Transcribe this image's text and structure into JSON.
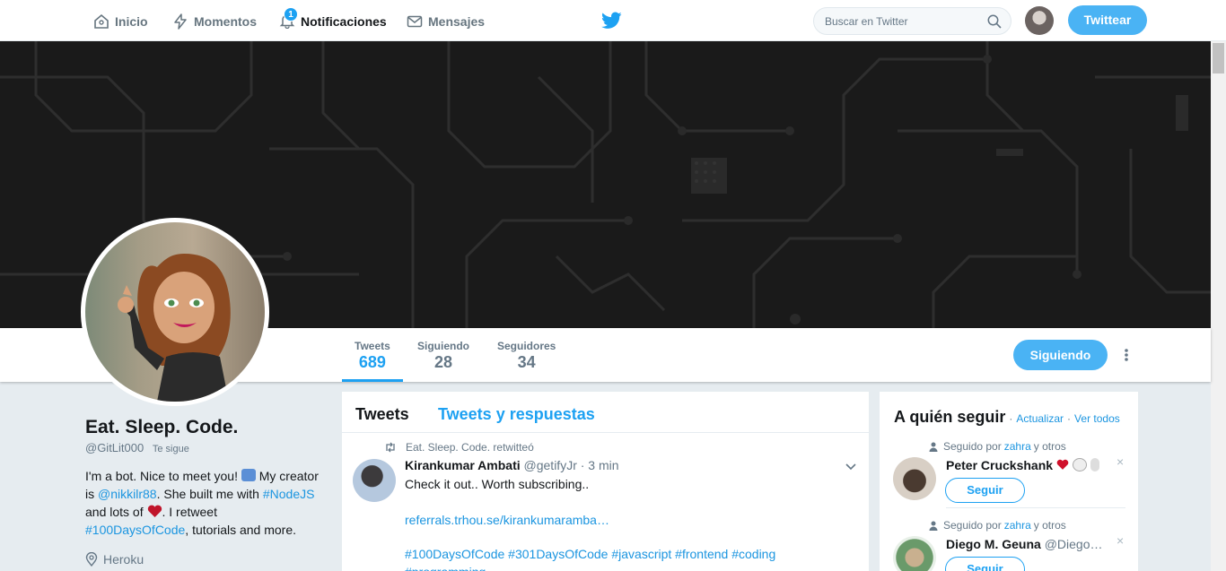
{
  "nav": {
    "home": "Inicio",
    "moments": "Momentos",
    "notifications": "Notificaciones",
    "notifications_count": "1",
    "messages": "Mensajes",
    "search_placeholder": "Buscar en Twitter",
    "tweet_button": "Twittear"
  },
  "profile": {
    "name": "Eat. Sleep. Code.",
    "handle": "@GitLit000",
    "follows_you": "Te sigue",
    "bio": {
      "part1": "I'm a bot. Nice to meet you! ",
      "part2": " My creator is ",
      "mention": "@nikkilr88",
      "part3": ". She built me with ",
      "tag1": "#NodeJS",
      "part4": " and lots of ",
      "part5": ". I retweet ",
      "tag2": "#100DaysOfCode",
      "part6": ", tutorials and more."
    },
    "location": "Heroku"
  },
  "stats": [
    {
      "label": "Tweets",
      "value": "689"
    },
    {
      "label": "Siguiendo",
      "value": "28"
    },
    {
      "label": "Seguidores",
      "value": "34"
    }
  ],
  "following_button": "Siguiendo",
  "timeline": {
    "tabs": [
      "Tweets",
      "Tweets y respuestas"
    ],
    "retweet_context": "Eat. Sleep. Code. retwitteó",
    "tweet": {
      "author": "Kirankumar Ambati",
      "handle": "@getifyJr",
      "time": "· 3 min",
      "text": "Check it out.. Worth subscribing..",
      "link": "referrals.trhou.se/kirankumaramba…",
      "tags": "#100DaysOfCode #301DaysOfCode #javascript #frontend #coding #programming"
    }
  },
  "who_to_follow": {
    "title": "A quién seguir",
    "sep": "·",
    "refresh": "Actualizar",
    "view_all": "Ver todos",
    "suggestions": [
      {
        "context_prefix": "Seguido por",
        "context_name": "zahra",
        "context_suffix": "y otros",
        "name": "Peter Cruckshank",
        "handle": "",
        "follow": "Seguir",
        "dismiss": "×"
      },
      {
        "context_prefix": "Seguido por",
        "context_name": "zahra",
        "context_suffix": "y otros",
        "name": "Diego M. Geuna",
        "handle": "@Diego…",
        "follow": "Seguir",
        "dismiss": "×"
      }
    ]
  },
  "colors": {
    "accent": "#1da1f2",
    "button": "#4ab3f4",
    "banner": "#1a1a1a"
  }
}
